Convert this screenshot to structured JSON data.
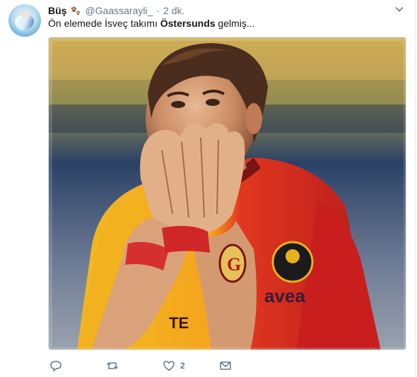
{
  "tweet": {
    "display_name": "Büş",
    "handle": "@Gaassarayli_",
    "separator": "·",
    "time": "2 dk.",
    "text_before": "Ön elemede İsveç takımı ",
    "text_bold": "Östersunds",
    "text_after": " gelmiş...",
    "media_icon": "photo-footballer-hands-on-face",
    "actions": {
      "reply_icon": "reply-icon",
      "retweet_icon": "retweet-icon",
      "like_icon": "heart-icon",
      "like_count": "2",
      "dm_icon": "envelope-icon"
    },
    "jersey_sponsor": "avea",
    "accent_color": "#657786"
  }
}
